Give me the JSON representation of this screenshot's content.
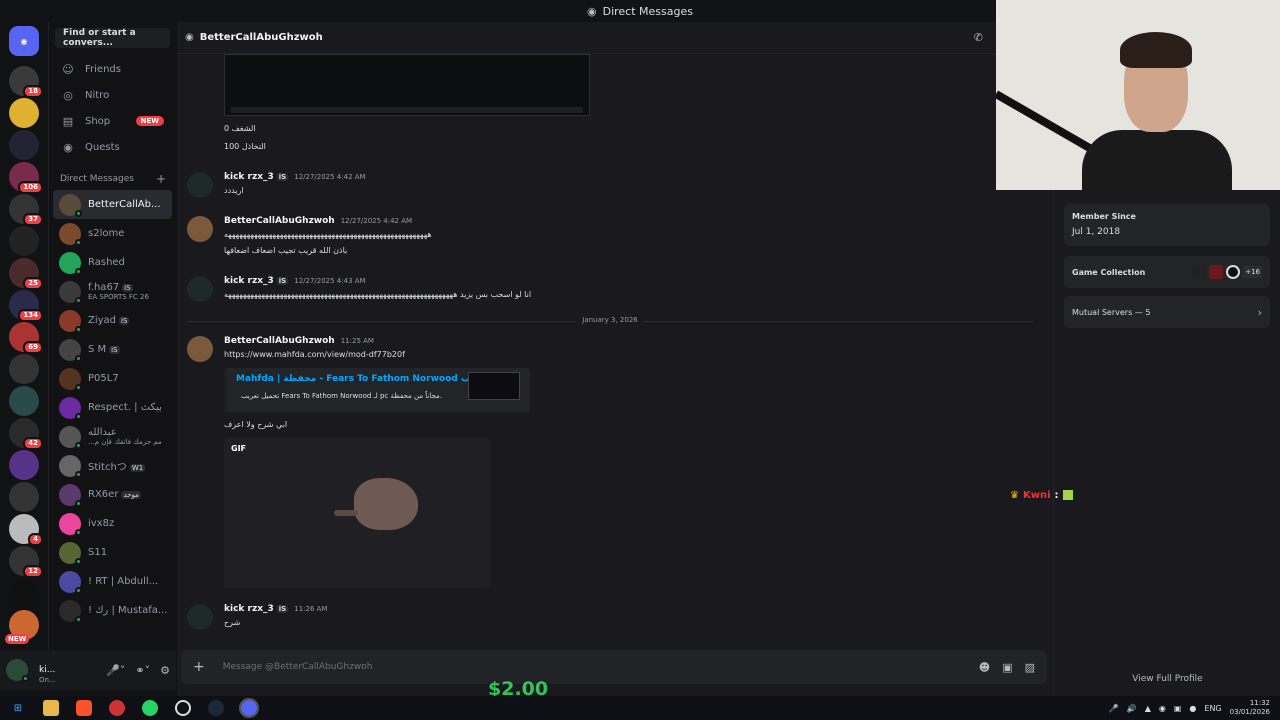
{
  "window": {
    "title": "Direct Messages"
  },
  "servers": {
    "badges": [
      "18",
      "",
      "",
      "106",
      "37",
      "",
      "25",
      "134",
      "69",
      "",
      "",
      "42",
      "",
      "",
      "4",
      "12",
      "",
      "NEW"
    ]
  },
  "dm_column": {
    "search_placeholder": "Find or start a convers...",
    "nav": [
      {
        "label": "Friends",
        "icon": "friends-icon"
      },
      {
        "label": "Nitro",
        "icon": "nitro-icon"
      },
      {
        "label": "Shop",
        "icon": "shop-icon",
        "pill": "NEW"
      },
      {
        "label": "Quests",
        "icon": "quests-icon"
      }
    ],
    "header": "Direct Messages",
    "add_symbol": "+",
    "dms": [
      {
        "name": "BetterCallAb...",
        "color": "#5a4a3a"
      },
      {
        "name": "s2lome",
        "color": "#7a4a2a"
      },
      {
        "name": "Rashed",
        "color": "#23a559"
      },
      {
        "name": "f.ha67",
        "tag": "iS",
        "sub": "EA SPORTS FC 26",
        "color": "#3a3a3a"
      },
      {
        "name": "Ziyad",
        "tag": "iS",
        "color": "#8a3a2a"
      },
      {
        "name": "S M",
        "tag": "iS",
        "color": "#444"
      },
      {
        "name": "P05L7",
        "color": "#553322"
      },
      {
        "name": "Respect. | بيكث",
        "color": "#6a2aa0"
      },
      {
        "name": "عبدالله",
        "sub": "...مم حزمك فائقك فإن م",
        "color": "#555"
      },
      {
        "name": "Stitchつ",
        "tag": "W1",
        "color": "#666"
      },
      {
        "name": "RX6er",
        "tag": "موحد",
        "color": "#5a3a6a"
      },
      {
        "name": "ivx8z",
        "color": "#eb459e"
      },
      {
        "name": "S11",
        "color": "#556633"
      },
      {
        "name": "! RT | Abdull...",
        "color": "#4a4aa0"
      },
      {
        "name": "! رك | Mustafa...",
        "color": "#2a2a2a"
      }
    ]
  },
  "user": {
    "name": "ki...",
    "status": "On..."
  },
  "chat": {
    "recipient": "BetterCallAbuGhzwoh",
    "pre_lines": [
      "الشغف 0",
      "التخاذل 100"
    ],
    "messages": [
      {
        "author": "kick rzx_3",
        "tag": "iS",
        "time": "12/27/2025 4:42 AM",
        "text": "اريددد"
      },
      {
        "author": "BetterCallAbuGhzwoh",
        "time": "12/27/2025 4:42 AM",
        "text": "هههههههههههههههههههههههههههههههههههههههههههههههههههههههه",
        "text2": "باذن الله قريب تجيب اضعاف اضعافها"
      },
      {
        "author": "kick rzx_3",
        "tag": "iS",
        "time": "12/27/2025 4:43 AM",
        "text": "انا لو اسحب بس يزيد ههههههههههههههههههههههههههههههههههههههههههههههههههههههههههههههه"
      },
      {
        "date_separator": "January 3, 2026"
      },
      {
        "author": "BetterCallAbuGhzwoh",
        "time": "11:25 AM",
        "link": "https://www.mahfda.com/view/mod-df77b20f",
        "embed_title": "Mahfda | محفظة - Fears To Fathom Norwood تعريب",
        "embed_desc": "تحميل تعريب Fears To Fathom Norwood لـ pc مجاناً من محفظة.",
        "text": "ابي شرح ولا اعرف",
        "gif_label": "GIF"
      },
      {
        "author": "kick rzx_3",
        "tag": "iS",
        "time": "11:26 AM",
        "text": "شرح"
      }
    ],
    "composer_placeholder": "Message @BetterCallAbuGhzwoh"
  },
  "profile": {
    "member_since_label": "Member Since",
    "member_since": "Jul 1, 2018",
    "game_collection_label": "Game Collection",
    "game_more": "+16",
    "mutual_servers": "Mutual Servers — 5",
    "view_full": "View Full Profile"
  },
  "overlay": {
    "price": "$2.00",
    "chat_user": "Kwni",
    "chat_sep": ":"
  },
  "taskbar": {
    "lang": "ENG",
    "time": "11:32",
    "date": "03/01/2026"
  }
}
